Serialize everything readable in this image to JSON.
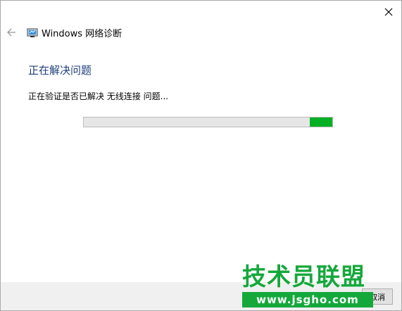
{
  "window": {
    "app_title": "Windows 网络诊断"
  },
  "main": {
    "heading": "正在解决问题",
    "status": "正在验证是否已解决 无线连接 问题..."
  },
  "progress": {
    "style": "marquee",
    "fill_color": "#06b025",
    "chunk_start_fraction": 0.91,
    "chunk_end_fraction": 1.0
  },
  "footer": {
    "cancel_label": "取消"
  },
  "watermark": {
    "title": "技术员联盟",
    "url": "www.jsgho.com"
  },
  "icons": {
    "close": "close-icon",
    "back": "back-arrow-icon",
    "app": "network-diagnostics-icon"
  }
}
